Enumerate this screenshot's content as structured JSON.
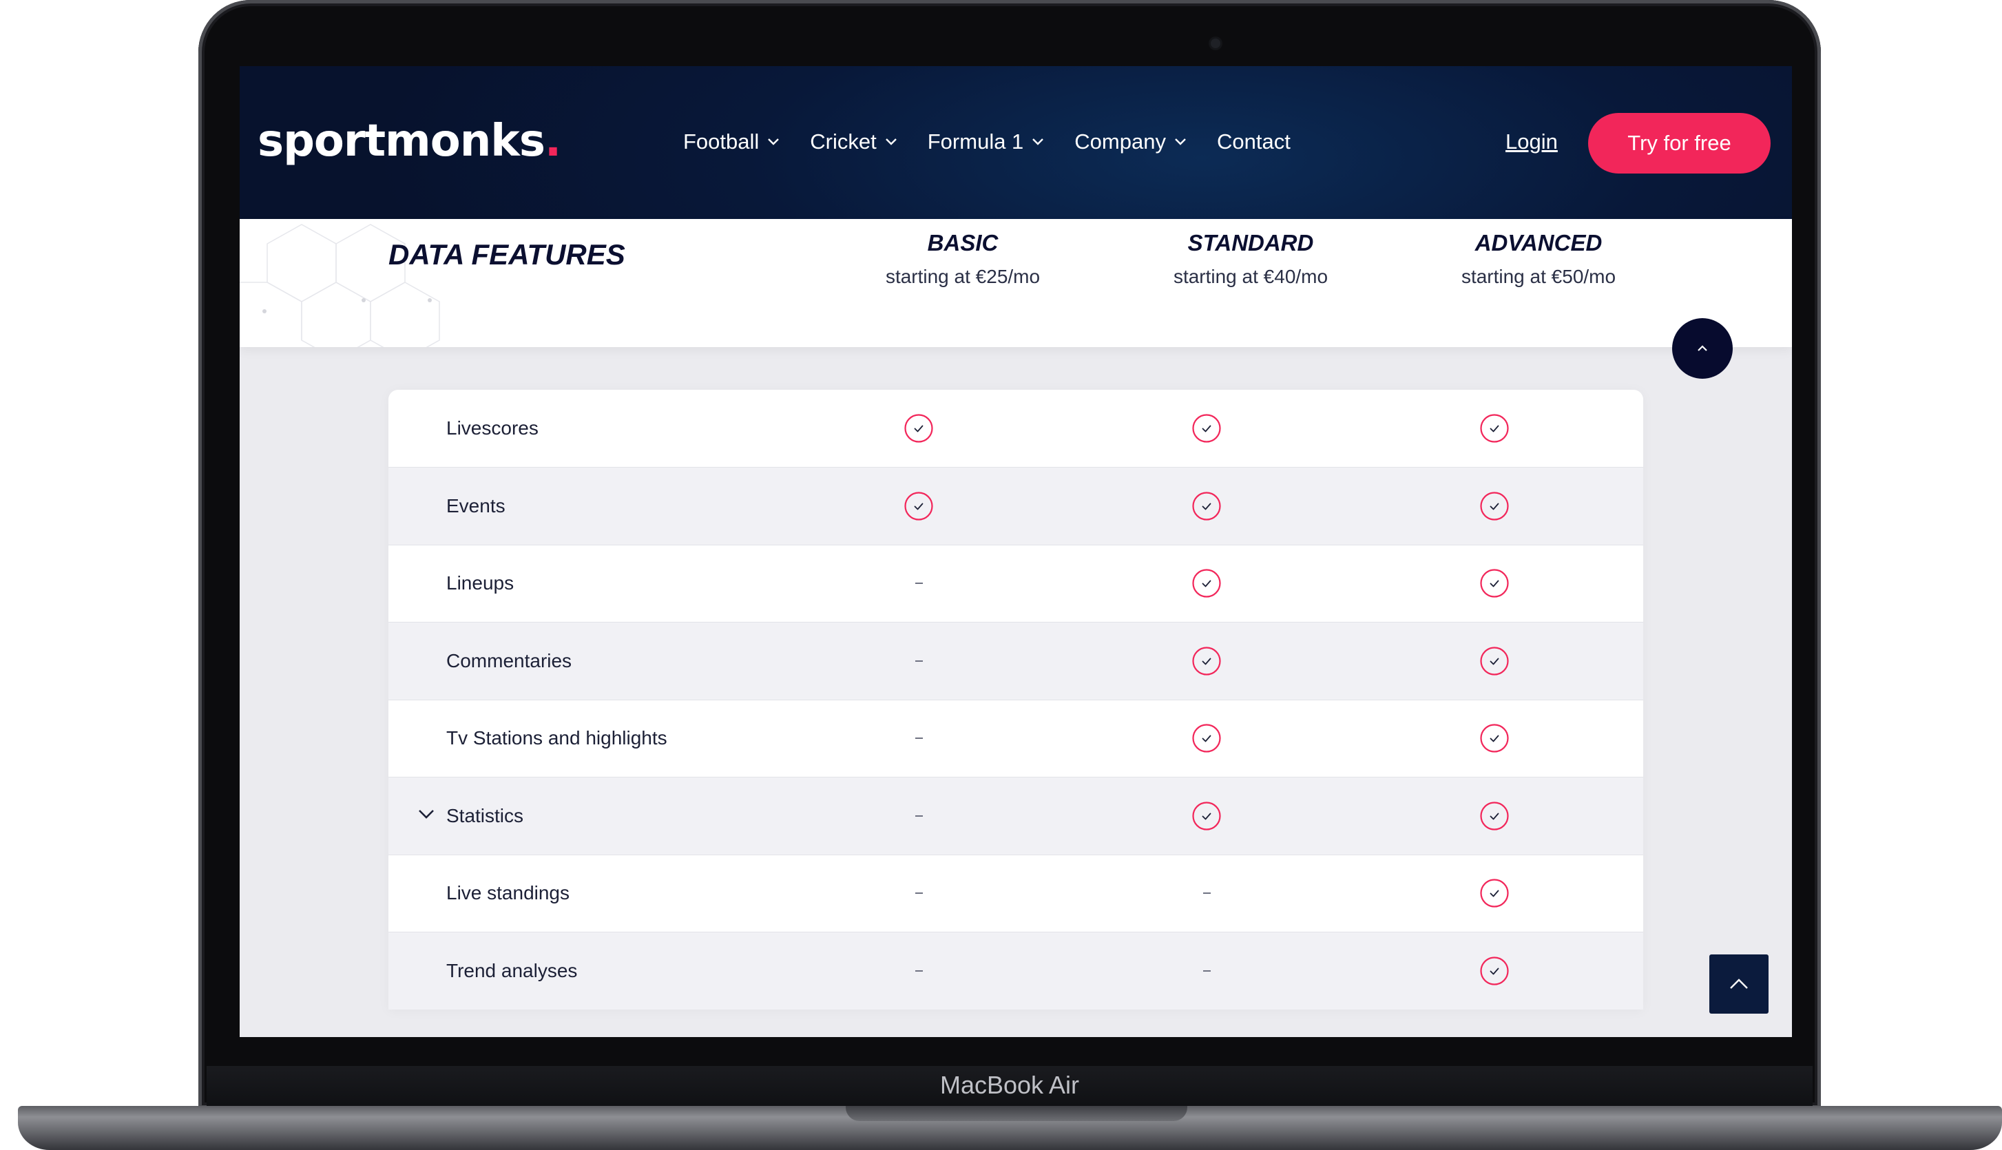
{
  "device": {
    "label": "MacBook Air"
  },
  "header": {
    "logo_text": "sportmonks",
    "logo_dot": ".",
    "nav": [
      {
        "label": "Football",
        "has_dropdown": true
      },
      {
        "label": "Cricket",
        "has_dropdown": true
      },
      {
        "label": "Formula 1",
        "has_dropdown": true
      },
      {
        "label": "Company",
        "has_dropdown": true
      },
      {
        "label": "Contact",
        "has_dropdown": false
      }
    ],
    "login_label": "Login",
    "cta_label": "Try for free"
  },
  "pricing_header": {
    "title": "DATA FEATURES",
    "plans": [
      {
        "name": "BASIC",
        "price": "starting at €25/mo"
      },
      {
        "name": "STANDARD",
        "price": "starting at €40/mo"
      },
      {
        "name": "ADVANCED",
        "price": "starting at €50/mo"
      }
    ]
  },
  "features": [
    {
      "name": "Livescores",
      "expandable": false,
      "basic": true,
      "standard": true,
      "advanced": true
    },
    {
      "name": "Events",
      "expandable": false,
      "basic": true,
      "standard": true,
      "advanced": true
    },
    {
      "name": "Lineups",
      "expandable": false,
      "basic": false,
      "standard": true,
      "advanced": true
    },
    {
      "name": "Commentaries",
      "expandable": false,
      "basic": false,
      "standard": true,
      "advanced": true
    },
    {
      "name": "Tv Stations and highlights",
      "expandable": false,
      "basic": false,
      "standard": true,
      "advanced": true
    },
    {
      "name": "Statistics",
      "expandable": true,
      "basic": false,
      "standard": true,
      "advanced": true
    },
    {
      "name": "Live standings",
      "expandable": false,
      "basic": false,
      "standard": false,
      "advanced": true
    },
    {
      "name": "Trend analyses",
      "expandable": false,
      "basic": false,
      "standard": false,
      "advanced": true
    }
  ],
  "colors": {
    "accent": "#f2265a",
    "navbar": "#07122d",
    "text_dark": "#0b0f30",
    "row_alt": "#f1f1f5"
  },
  "icons": {
    "included": "check-circle-icon",
    "not_included": "dash-icon",
    "expand": "chevron-down-icon",
    "scroll_up": "chevron-up-icon"
  }
}
